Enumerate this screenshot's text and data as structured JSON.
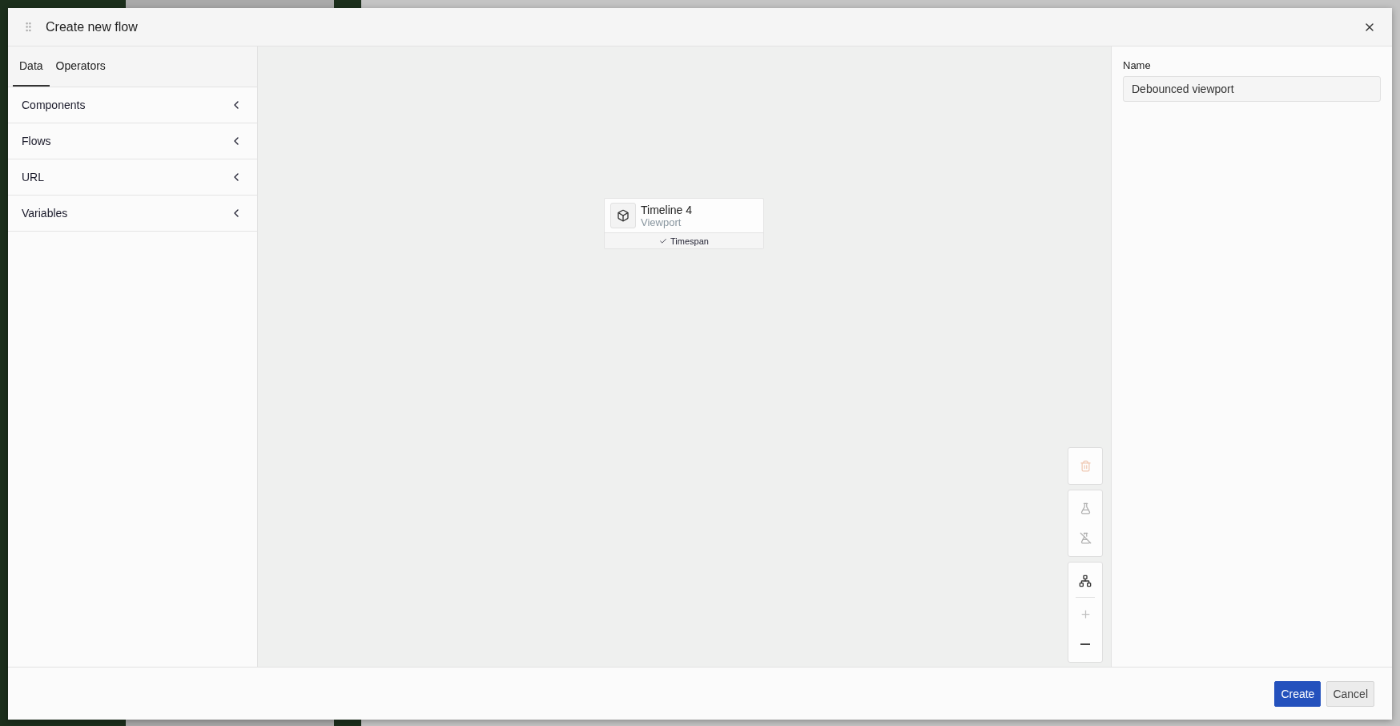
{
  "dialog": {
    "title": "Create new flow"
  },
  "tabs": [
    {
      "label": "Data",
      "selected": true
    },
    {
      "label": "Operators",
      "selected": false
    }
  ],
  "sections": [
    {
      "label": "Components",
      "expanded": false
    },
    {
      "label": "Flows",
      "expanded": false
    },
    {
      "label": "URL",
      "expanded": false
    },
    {
      "label": "Variables",
      "expanded": false
    }
  ],
  "node": {
    "title": "Timeline 4",
    "subtitle": "Viewport",
    "port": {
      "label": "Timespan",
      "checked": true
    }
  },
  "toolbar": [
    {
      "buttons": [
        {
          "kind": "delete",
          "disabled": true
        }
      ]
    },
    {
      "buttons": [
        {
          "kind": "flask",
          "disabled": true
        },
        {
          "kind": "flask-off",
          "disabled": true
        }
      ]
    },
    {
      "buttons": [
        {
          "kind": "layout",
          "disabled": false
        },
        {
          "kind": "zoom-in",
          "disabled": true
        },
        {
          "kind": "zoom-out",
          "disabled": false
        }
      ]
    }
  ],
  "name_field": {
    "label": "Name",
    "value": "Debounced viewport"
  },
  "buttons": [
    {
      "label": "Create",
      "kind": "primary"
    },
    {
      "label": "Cancel",
      "kind": "secondary"
    }
  ]
}
